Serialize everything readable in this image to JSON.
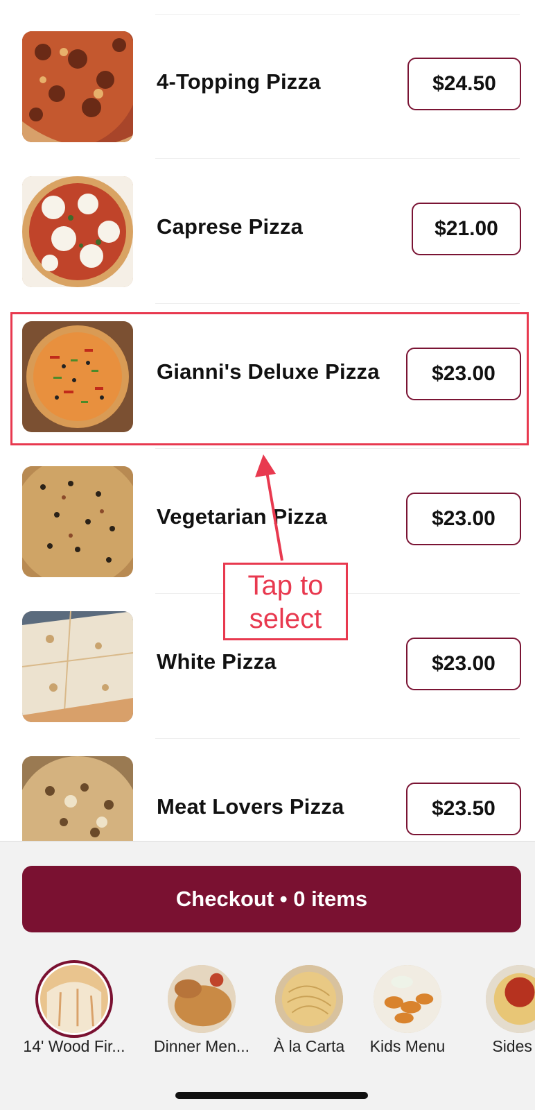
{
  "menu_items": [
    {
      "name": "4-Topping Pizza",
      "price": "$24.50"
    },
    {
      "name": "Caprese Pizza",
      "price": "$21.00"
    },
    {
      "name": "Gianni's Deluxe Pizza",
      "price": "$23.00"
    },
    {
      "name": "Vegetarian Pizza",
      "price": "$23.00"
    },
    {
      "name": "White Pizza",
      "price": "$23.00"
    },
    {
      "name": "Meat Lovers Pizza",
      "price": "$23.50"
    }
  ],
  "annotation": {
    "text_line1": "Tap to",
    "text_line2": "select"
  },
  "checkout": {
    "label": "Checkout • 0 items"
  },
  "categories": [
    {
      "label": "14' Wood Fir...",
      "selected": true
    },
    {
      "label": "Dinner Men...",
      "selected": false
    },
    {
      "label": "À la Carta",
      "selected": false
    },
    {
      "label": "Kids Menu",
      "selected": false
    },
    {
      "label": "Sides &",
      "selected": false
    }
  ],
  "colors": {
    "accent": "#7a1131",
    "annotation": "#e8394f"
  }
}
